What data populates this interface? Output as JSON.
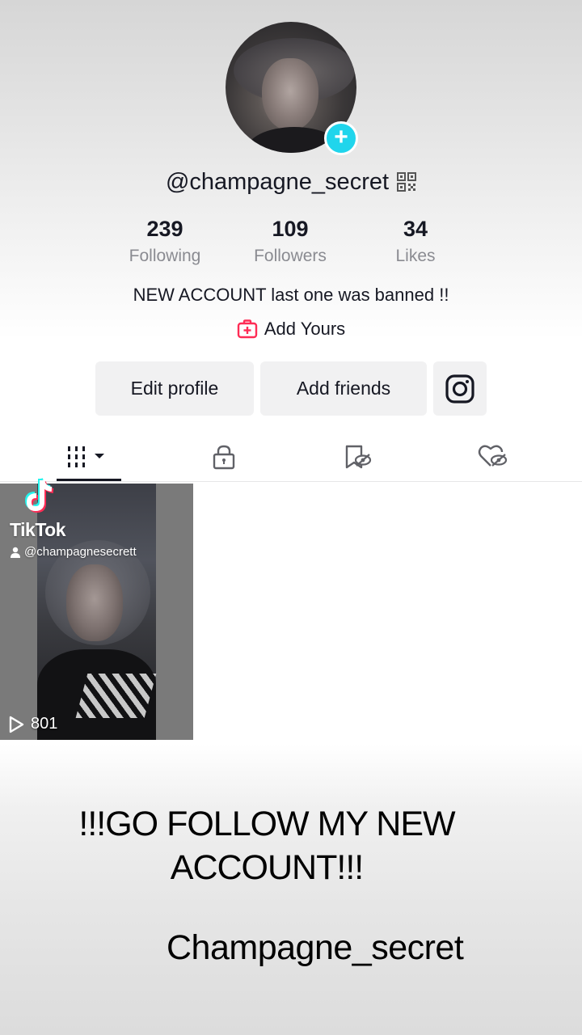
{
  "profile": {
    "username": "@champagne_secret",
    "bio": "NEW ACCOUNT last one was banned !!",
    "add_yours_label": "Add Yours"
  },
  "stats": [
    {
      "value": "239",
      "label": "Following"
    },
    {
      "value": "109",
      "label": "Followers"
    },
    {
      "value": "34",
      "label": "Likes"
    }
  ],
  "buttons": {
    "edit_profile": "Edit profile",
    "add_friends": "Add friends"
  },
  "tabs": [
    {
      "icon": "grid-icon",
      "active": true
    },
    {
      "icon": "lock-icon",
      "active": false
    },
    {
      "icon": "bookmark-hidden-icon",
      "active": false
    },
    {
      "icon": "heart-hidden-icon",
      "active": false
    }
  ],
  "video": {
    "watermark_brand": "TikTok",
    "watermark_handle": "@champagnesecrett",
    "views": "801"
  },
  "overlay": {
    "line1": "!!!GO FOLLOW MY NEW ACCOUNT!!!",
    "line2": "Champagne_secret"
  },
  "colors": {
    "accent_teal": "#20d5ec",
    "add_yours_pink": "#fe2c55",
    "text_primary": "#161823",
    "text_secondary": "#8a8b91",
    "button_bg": "#f1f1f2"
  }
}
